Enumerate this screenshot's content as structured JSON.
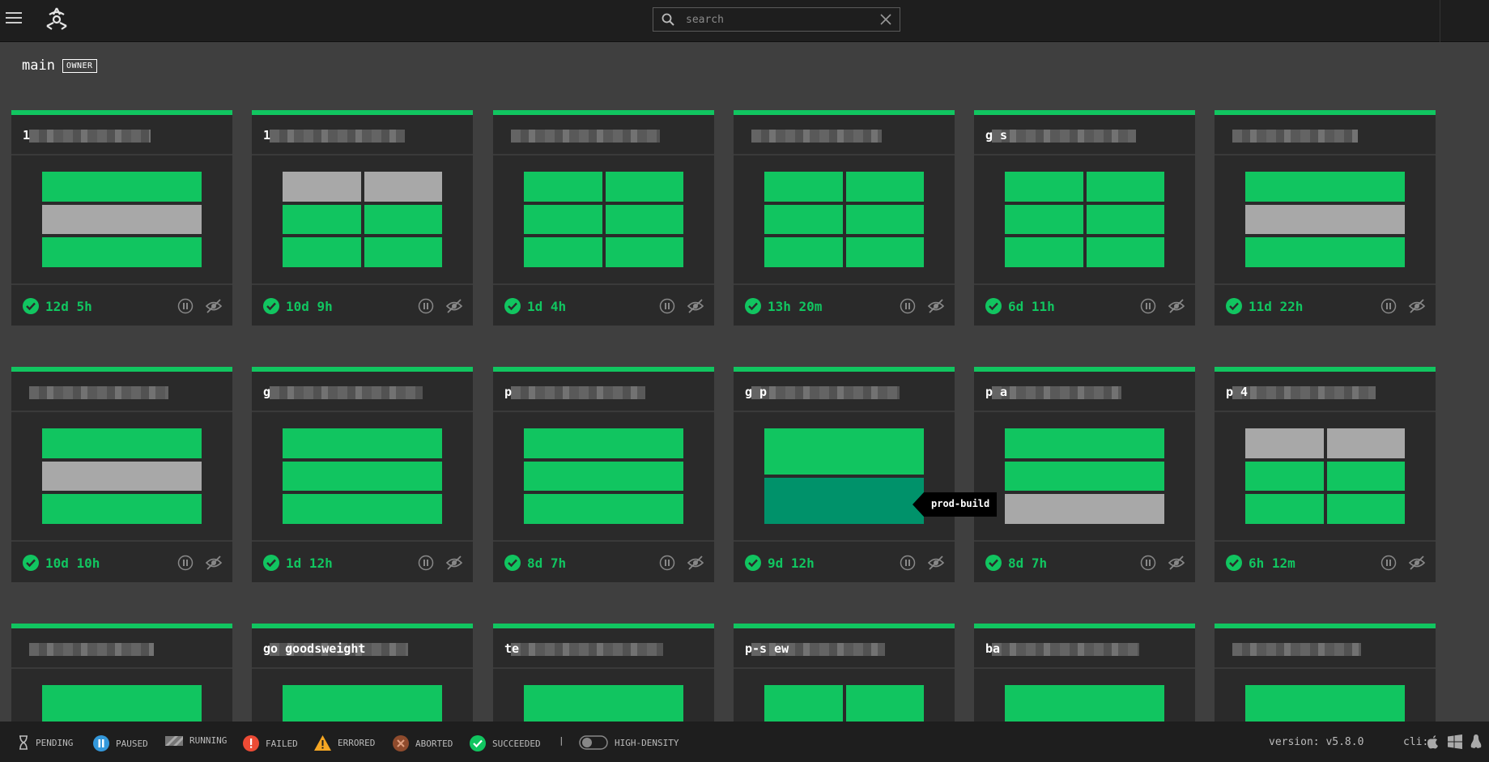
{
  "search": {
    "placeholder": "search"
  },
  "team": {
    "name": "main",
    "role_badge": "OWNER"
  },
  "cards": [
    {
      "title": "1",
      "since": "12d 5h",
      "cols": 1,
      "jobs": [
        "s",
        "p",
        "s"
      ]
    },
    {
      "title": "1",
      "since": "10d 9h",
      "cols": 2,
      "jobs": [
        "p",
        "p",
        "s",
        "s",
        "s",
        "s"
      ]
    },
    {
      "title": "",
      "since": "1d 4h",
      "cols": 2,
      "jobs": [
        "s",
        "s",
        "s",
        "s",
        "s",
        "s"
      ]
    },
    {
      "title": "",
      "since": "13h 20m",
      "cols": 2,
      "jobs": [
        "s",
        "s",
        "s",
        "s",
        "s",
        "s"
      ]
    },
    {
      "title": "g s",
      "since": "6d 11h",
      "cols": 2,
      "jobs": [
        "s",
        "s",
        "s",
        "s",
        "s",
        "s"
      ]
    },
    {
      "title": "",
      "since": "11d 22h",
      "cols": 1,
      "jobs": [
        "s",
        "p",
        "s"
      ]
    },
    {
      "title": "",
      "since": "10d 10h",
      "cols": 1,
      "jobs": [
        "s",
        "p",
        "s"
      ]
    },
    {
      "title": "g",
      "since": "1d 12h",
      "cols": 1,
      "jobs": [
        "s",
        "s",
        "s"
      ]
    },
    {
      "title": "p",
      "since": "8d 7h",
      "cols": 1,
      "jobs": [
        "s",
        "s",
        "s"
      ]
    },
    {
      "title": "g p",
      "since": "9d 12h",
      "cols": 1,
      "jobs": [
        "s",
        "h"
      ]
    },
    {
      "title": "p a",
      "since": "8d 7h",
      "cols": 1,
      "jobs": [
        "s",
        "s",
        "p"
      ]
    },
    {
      "title": "p 4",
      "since": "6h 12m",
      "cols": 2,
      "jobs": [
        "p",
        "p",
        "s",
        "s",
        "s",
        "s"
      ]
    },
    {
      "title": "",
      "since": "",
      "cols": 1,
      "jobs": [
        "s"
      ]
    },
    {
      "title": "go goodsweight",
      "since": "",
      "cols": 1,
      "jobs": [
        "s"
      ]
    },
    {
      "title": "te",
      "since": "",
      "cols": 1,
      "jobs": [
        "s"
      ]
    },
    {
      "title": "p-s ew",
      "since": "",
      "cols": 2,
      "jobs": [
        "s",
        "s"
      ]
    },
    {
      "title": "ba",
      "since": "",
      "cols": 1,
      "jobs": [
        "s"
      ]
    },
    {
      "title": "",
      "since": "",
      "cols": 1,
      "jobs": [
        "s"
      ]
    }
  ],
  "tooltip": {
    "text": "prod-build"
  },
  "legend": [
    {
      "key": "pending",
      "label": "PENDING"
    },
    {
      "key": "paused",
      "label": "PAUSED"
    },
    {
      "key": "running",
      "label": "RUNNING"
    },
    {
      "key": "failed",
      "label": "FAILED"
    },
    {
      "key": "errored",
      "label": "ERRORED"
    },
    {
      "key": "aborted",
      "label": "ABORTED"
    },
    {
      "key": "succeeded",
      "label": "SUCCEEDED"
    }
  ],
  "footer": {
    "separator": "|",
    "high_density_label": "HIGH-DENSITY",
    "version": "version: v5.8.0",
    "cli_label": "cli:"
  },
  "colors": {
    "succeeded": "#11c560",
    "paused": "#a8a8a8",
    "hovered_job": "#00926a",
    "background": "#3f3f3f"
  },
  "icons": [
    "menu-icon",
    "concourse-logo",
    "search-icon",
    "clear-icon",
    "check-icon",
    "pause-icon",
    "eye-slash-icon",
    "apple-icon",
    "windows-icon",
    "linux-icon"
  ]
}
